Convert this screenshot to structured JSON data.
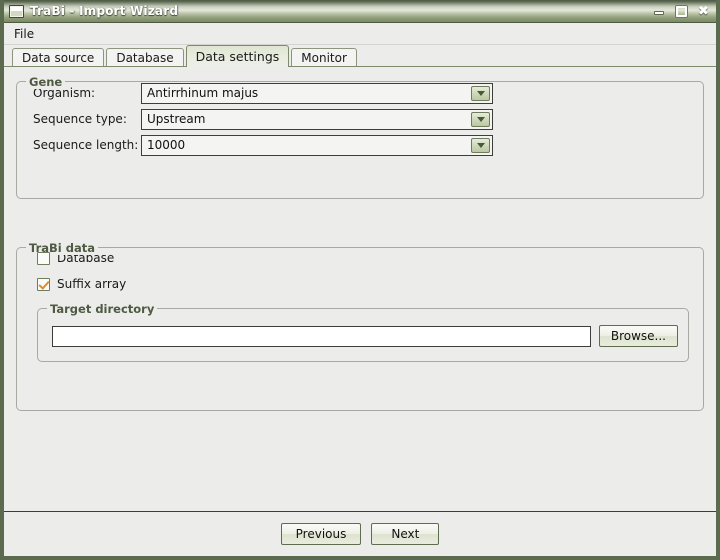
{
  "window": {
    "title": "TraBi - Import Wizard",
    "icon": "window-icon",
    "controls": {
      "minimize": "minimize-icon",
      "maximize": "maximize-icon",
      "close": "✖"
    }
  },
  "menubar": {
    "items": [
      {
        "label": "File"
      }
    ]
  },
  "tabs": [
    {
      "label": "Data source",
      "active": false
    },
    {
      "label": "Database",
      "active": false
    },
    {
      "label": "Data settings",
      "active": true
    },
    {
      "label": "Monitor",
      "active": false
    }
  ],
  "gene": {
    "title": "Gene",
    "fields": [
      {
        "label": "Organism:",
        "value": "Antirrhinum majus"
      },
      {
        "label": "Sequence type:",
        "value": "Upstream"
      },
      {
        "label": "Sequence length:",
        "value": "10000"
      }
    ]
  },
  "trabi": {
    "title": "TraBi data",
    "checkboxes": [
      {
        "label": "Database",
        "checked": false
      },
      {
        "label": "Suffix array",
        "checked": true
      }
    ],
    "target_directory": {
      "title": "Target directory",
      "path_value": "",
      "path_placeholder": "",
      "browse_label": "Browse..."
    }
  },
  "footer": {
    "previous_label": "Previous",
    "next_label": "Next"
  },
  "colors": {
    "titlebar_dark": "#4e5a43",
    "titlebar_light": "#e4e8da",
    "window_border": "#5c6a4f",
    "panel_bg": "#ececeb",
    "group_title": "#4e5a42",
    "active_tab": "#e3e8d6",
    "check_accent": "#e08a2e",
    "combo_button": "#cfd8bc"
  }
}
